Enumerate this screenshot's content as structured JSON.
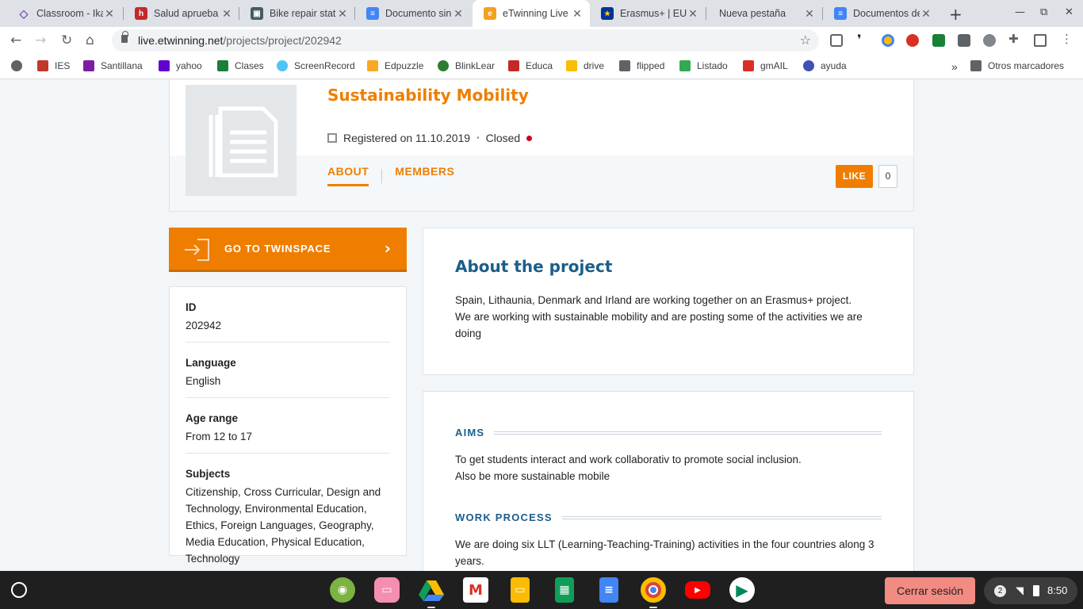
{
  "browser": {
    "tabs": [
      {
        "title": "Classroom - Ika",
        "color": "#7e57c2",
        "glyph": "◇"
      },
      {
        "title": "Salud aprueba",
        "color": "#c62828",
        "glyph": "h"
      },
      {
        "title": "Bike repair stati",
        "color": "#455a64",
        "glyph": "▣"
      },
      {
        "title": "Documento sin",
        "color": "#4285f4",
        "glyph": "≡"
      },
      {
        "title": "eTwinning Live",
        "color": "#f4a021",
        "glyph": "e"
      },
      {
        "title": "Erasmus+ | EU",
        "color": "#003399",
        "glyph": "★"
      },
      {
        "title": "Nueva pestaña",
        "color": "#dee1e6",
        "glyph": ""
      },
      {
        "title": "Documentos de",
        "color": "#4285f4",
        "glyph": "≡"
      }
    ],
    "new_tab_glyph": "+",
    "url_host": "live.etwinning.net",
    "url_path": "/projects/project/202942",
    "bookmarks": [
      {
        "label": "",
        "color": "#5f6368"
      },
      {
        "label": "IES",
        "color": "#c0392b"
      },
      {
        "label": "Santillana",
        "color": "#7b1fa2"
      },
      {
        "label": "yahoo",
        "color": "#6001d2"
      },
      {
        "label": "Clases",
        "color": "#188038"
      },
      {
        "label": "ScreenRecord",
        "color": "#4fc3f7"
      },
      {
        "label": "Edpuzzle",
        "color": "#f9a825"
      },
      {
        "label": "BlinkLear",
        "color": "#2e7d32"
      },
      {
        "label": "Educa",
        "color": "#c62828"
      },
      {
        "label": "drive",
        "color": "#fbbc04"
      },
      {
        "label": "flipped",
        "color": "#5f6368"
      },
      {
        "label": "Listado",
        "color": "#34a853"
      },
      {
        "label": "gmAIL",
        "color": "#d93025"
      },
      {
        "label": "ayuda",
        "color": "#3f51b5"
      }
    ],
    "bookmarks_overflow": "»",
    "other_bookmarks": "Otros marcadores"
  },
  "project": {
    "title": "Sustainability Mobility",
    "registered": "Registered on 11.10.2019",
    "separator": "•",
    "status": "Closed",
    "tab_about": "ABOUT",
    "tab_members": "MEMBERS",
    "like_label": "LIKE",
    "like_count": "0",
    "twinspace_label": "GO TO TWINSPACE",
    "info": [
      {
        "key": "ID",
        "value": "202942"
      },
      {
        "key": "Language",
        "value": "English"
      },
      {
        "key": "Age range",
        "value": "From 12 to 17"
      },
      {
        "key": "Subjects",
        "value": "Citizenship, Cross Curricular, Design and Technology, Environmental Education, Ethics, Foreign Languages, Geography, Media Education, Physical Education, Technology"
      }
    ],
    "about_heading": "About the project",
    "about_line1": "Spain, Lithaunia, Denmark and Irland are working together on an Erasmus+ project.",
    "about_line2": "We are working with sustainable mobility and are posting some of the activities we are doing",
    "aims_heading": "AIMS",
    "aims_line1": "To get students interact and work collaborativ to promote social inclusion.",
    "aims_line2": "Also be more sustainable mobile",
    "work_heading": "WORK PROCESS",
    "work_text": "We are doing six LLT (Learning-Teaching-Training) activities in the four countries along 3 years."
  },
  "shelf": {
    "logout_label": "Cerrar sesión",
    "notification_count": "2",
    "time": "8:50"
  },
  "colors": {
    "accent": "#ef7e00",
    "heading": "#1b5e8a",
    "status_closed": "#d0021b"
  }
}
